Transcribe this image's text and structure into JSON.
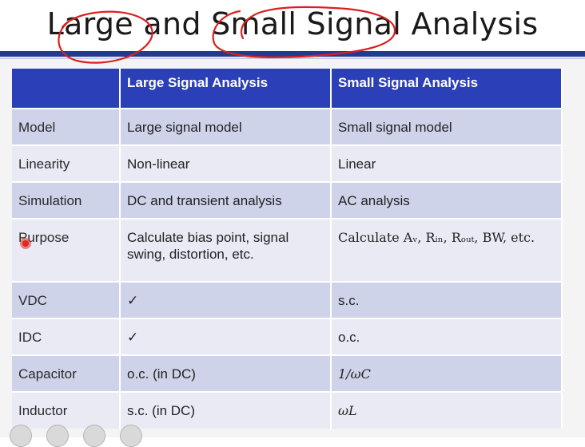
{
  "slide": {
    "title": "Large and Small Signal Analysis",
    "title_parts": [
      "Large",
      " and ",
      "Small Signal",
      " Analysis"
    ]
  },
  "table": {
    "headers": [
      "",
      "Large Signal Analysis",
      "Small Signal Analysis"
    ],
    "rows": [
      {
        "label": "Model",
        "large": "Large signal model",
        "small": "Small signal model"
      },
      {
        "label": "Linearity",
        "large": "Non-linear",
        "small": "Linear"
      },
      {
        "label": "Simulation",
        "large": "DC and transient analysis",
        "small": "AC analysis"
      },
      {
        "label": "Purpose",
        "large": "Calculate bias point, signal swing, distortion, etc.",
        "small": "Calculate Aᵥ, Rᵢₙ, Rₒᵤₜ, BW, etc."
      },
      {
        "label": "VDC",
        "large": "✓",
        "small": "s.c."
      },
      {
        "label": "IDC",
        "large": "✓",
        "small": "o.c."
      },
      {
        "label": "Capacitor",
        "large": "o.c. (in DC)",
        "small": "1/ωC"
      },
      {
        "label": "Inductor",
        "large": "s.c. (in DC)",
        "small": "ωL"
      }
    ]
  },
  "annotations": {
    "ink_color": "#d92020",
    "pointer_color": "#e0281e"
  },
  "icons": [
    "subtitles-icon",
    "zoom-icon",
    "screen-icon",
    "more-icon"
  ]
}
